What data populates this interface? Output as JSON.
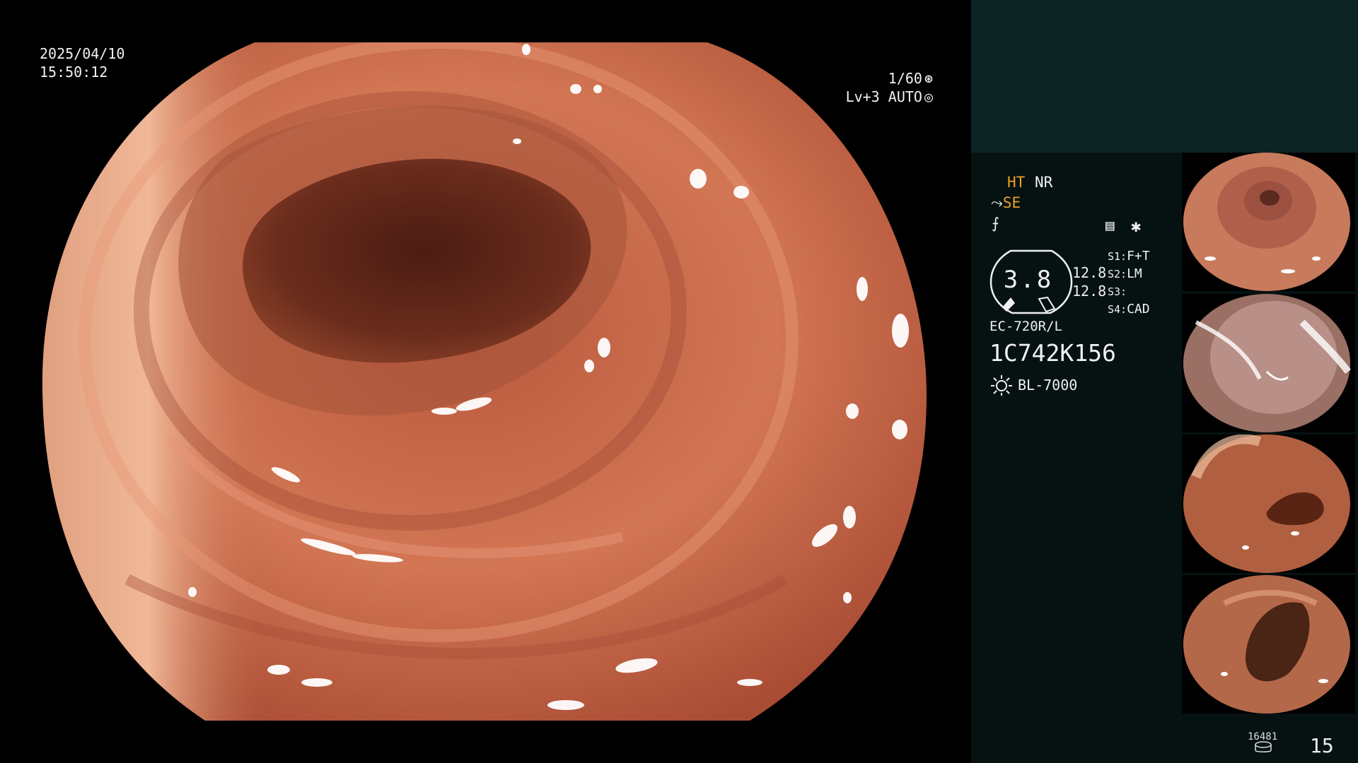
{
  "osd": {
    "date": "2025/04/10",
    "time": "15:50:12",
    "shutter": "1/60",
    "exposure_level": "Lv+3",
    "iris_mode": "AUTO"
  },
  "status": {
    "ht": "HT",
    "nr": "NR",
    "se": "SE",
    "gauge_value": "3.8",
    "value_upper": "12.8",
    "value_lower": "12.8",
    "switches": [
      {
        "key": "S1:",
        "value": "F+T"
      },
      {
        "key": "S2:",
        "value": "LM"
      },
      {
        "key": "S3:",
        "value": ""
      },
      {
        "key": "S4:",
        "value": "CAD"
      }
    ],
    "scope_model": "EC-720R/L",
    "scope_serial": "1C742K156",
    "light_source": "BL-7000"
  },
  "footer": {
    "stored_count": "16481",
    "frame_count": "15"
  },
  "colors": {
    "mucosa": "#c86a4c",
    "lumen": "#5a2418",
    "side_top": "#0d2424",
    "side_body": "#061212",
    "amber": "#f0a020"
  },
  "icons": [
    "shutter-icon",
    "iris-icon",
    "enhance-mode-icon",
    "flush-mode-icon",
    "settings-icon",
    "asterisk-icon",
    "light-source-icon",
    "storage-icon"
  ]
}
